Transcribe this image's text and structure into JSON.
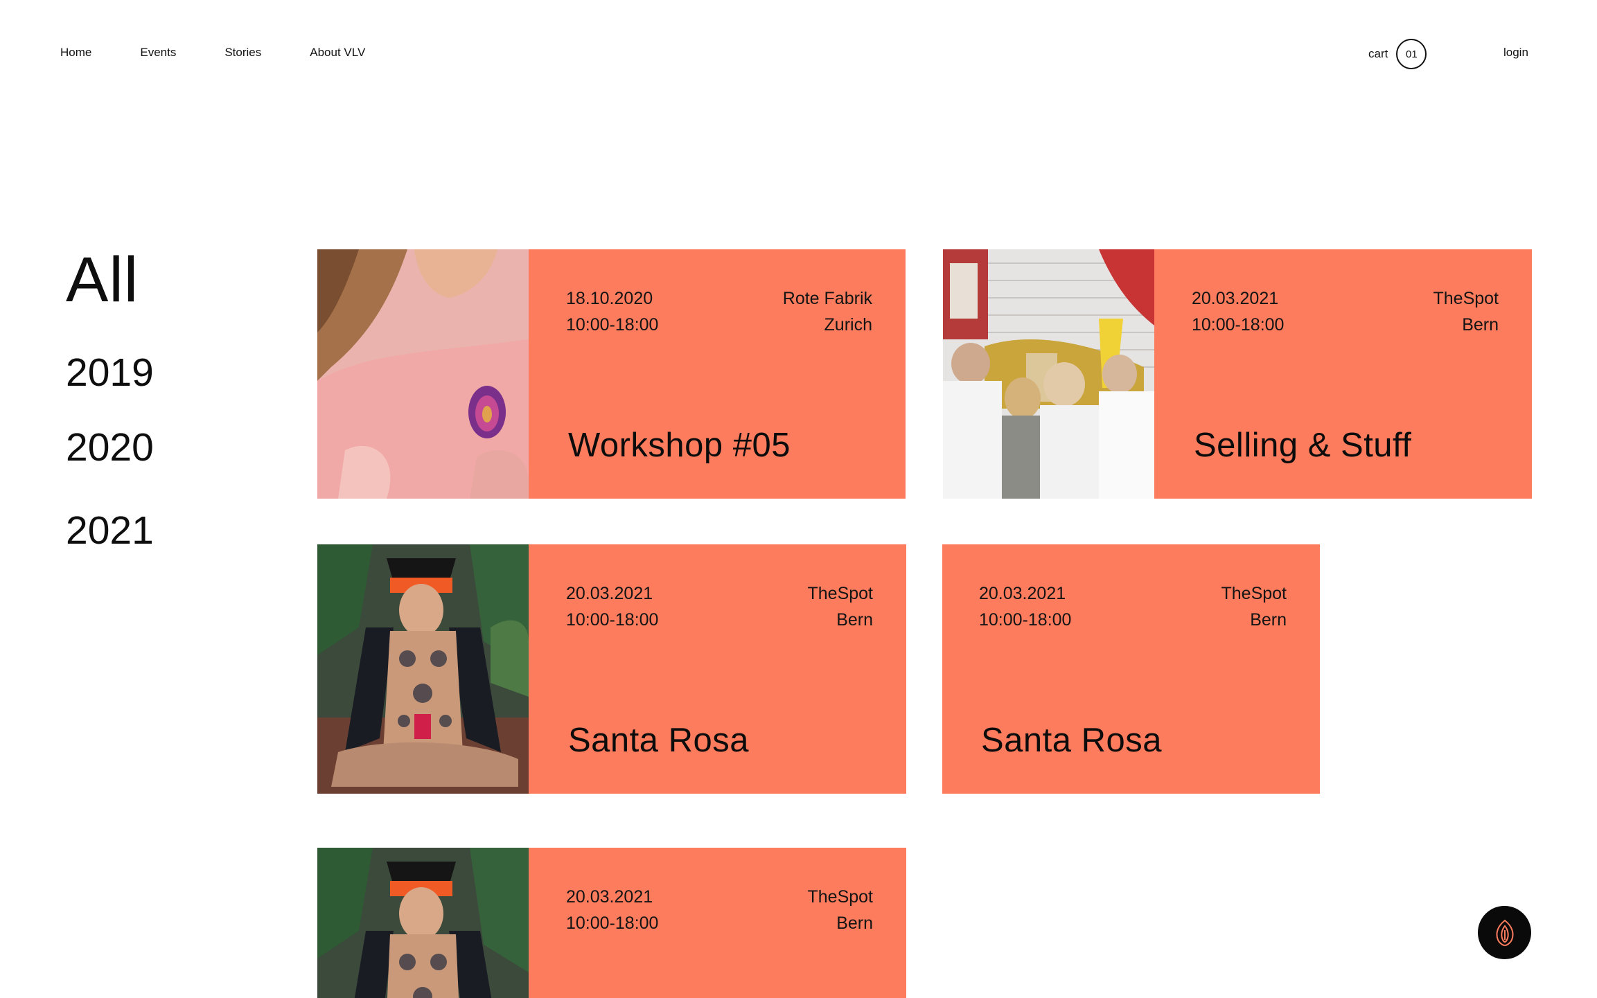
{
  "nav": {
    "items": [
      {
        "label": "Home"
      },
      {
        "label": "Events"
      },
      {
        "label": "Stories"
      },
      {
        "label": "About VLV"
      }
    ],
    "cart_label": "cart",
    "cart_count": "01",
    "login_label": "login"
  },
  "filters": {
    "all": "All",
    "years": [
      "2019",
      "2020",
      "2021"
    ]
  },
  "events": [
    {
      "date": "18.10.2020",
      "time": "10:00-18:00",
      "venue": "Rote Fabrik",
      "city": "Zurich",
      "title": "Workshop #05",
      "image": "pink-sweater-photo"
    },
    {
      "date": "20.03.2021",
      "time": "10:00-18:00",
      "venue": "TheSpot",
      "city": "Bern",
      "title": "Selling & Stuff",
      "image": "street-crowd-photo"
    },
    {
      "date": "20.03.2021",
      "time": "10:00-18:00",
      "venue": "TheSpot",
      "city": "Bern",
      "title": "Santa Rosa",
      "image": "tattooed-person-photo"
    },
    {
      "date": "20.03.2021",
      "time": "10:00-18:00",
      "venue": "TheSpot",
      "city": "Bern",
      "title": "Santa Rosa"
    },
    {
      "date": "20.03.2021",
      "time": "10:00-18:00",
      "venue": "TheSpot",
      "city": "Bern",
      "title": "",
      "image": "tattooed-person-photo"
    }
  ],
  "colors": {
    "card_background": "#fd7c5d",
    "text": "#111111",
    "fab_background": "#0a0a0a",
    "fab_icon": "#fd7c5d"
  },
  "fab": {
    "icon": "vlv-logo-icon"
  }
}
